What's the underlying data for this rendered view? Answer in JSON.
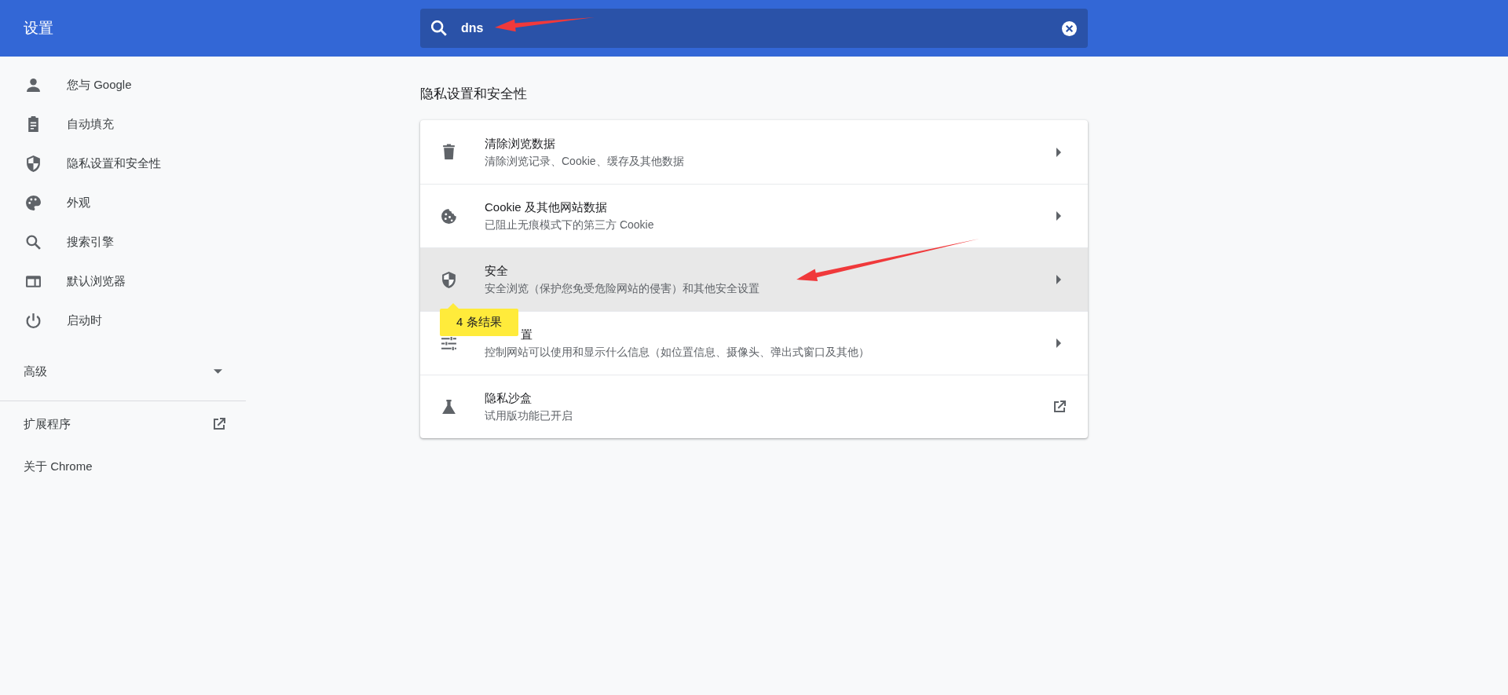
{
  "header": {
    "title": "设置",
    "search": {
      "value": "dns"
    }
  },
  "sidebar": {
    "items": [
      {
        "label": "您与 Google"
      },
      {
        "label": "自动填充"
      },
      {
        "label": "隐私设置和安全性"
      },
      {
        "label": "外观"
      },
      {
        "label": "搜索引擎"
      },
      {
        "label": "默认浏览器"
      },
      {
        "label": "启动时"
      }
    ],
    "advanced": {
      "label": "高级",
      "expanded": false
    },
    "links": [
      {
        "label": "扩展程序",
        "kind": "external"
      },
      {
        "label": "关于 Chrome",
        "kind": "plain"
      }
    ]
  },
  "section": {
    "title": "隐私设置和安全性",
    "rows": [
      {
        "title": "清除浏览数据",
        "subtitle": "清除浏览记录、Cookie、缓存及其他数据",
        "kind": "submenu",
        "selected": false
      },
      {
        "title": "Cookie 及其他网站数据",
        "subtitle": "已阻止无痕模式下的第三方 Cookie",
        "kind": "submenu",
        "selected": false
      },
      {
        "title": "安全",
        "subtitle": "安全浏览（保护您免受危险网站的侵害）和其他安全设置",
        "kind": "submenu",
        "selected": true
      },
      {
        "title": "置",
        "subtitle": "控制网站可以使用和显示什么信息（如位置信息、摄像头、弹出式窗口及其他）",
        "kind": "submenu",
        "selected": false
      },
      {
        "title": "隐私沙盒",
        "subtitle": "试用版功能已开启",
        "kind": "external",
        "selected": false
      }
    ],
    "tooltip": "4 条结果"
  },
  "annotations": [
    {
      "kind": "arrow"
    },
    {
      "kind": "arrow"
    }
  ]
}
